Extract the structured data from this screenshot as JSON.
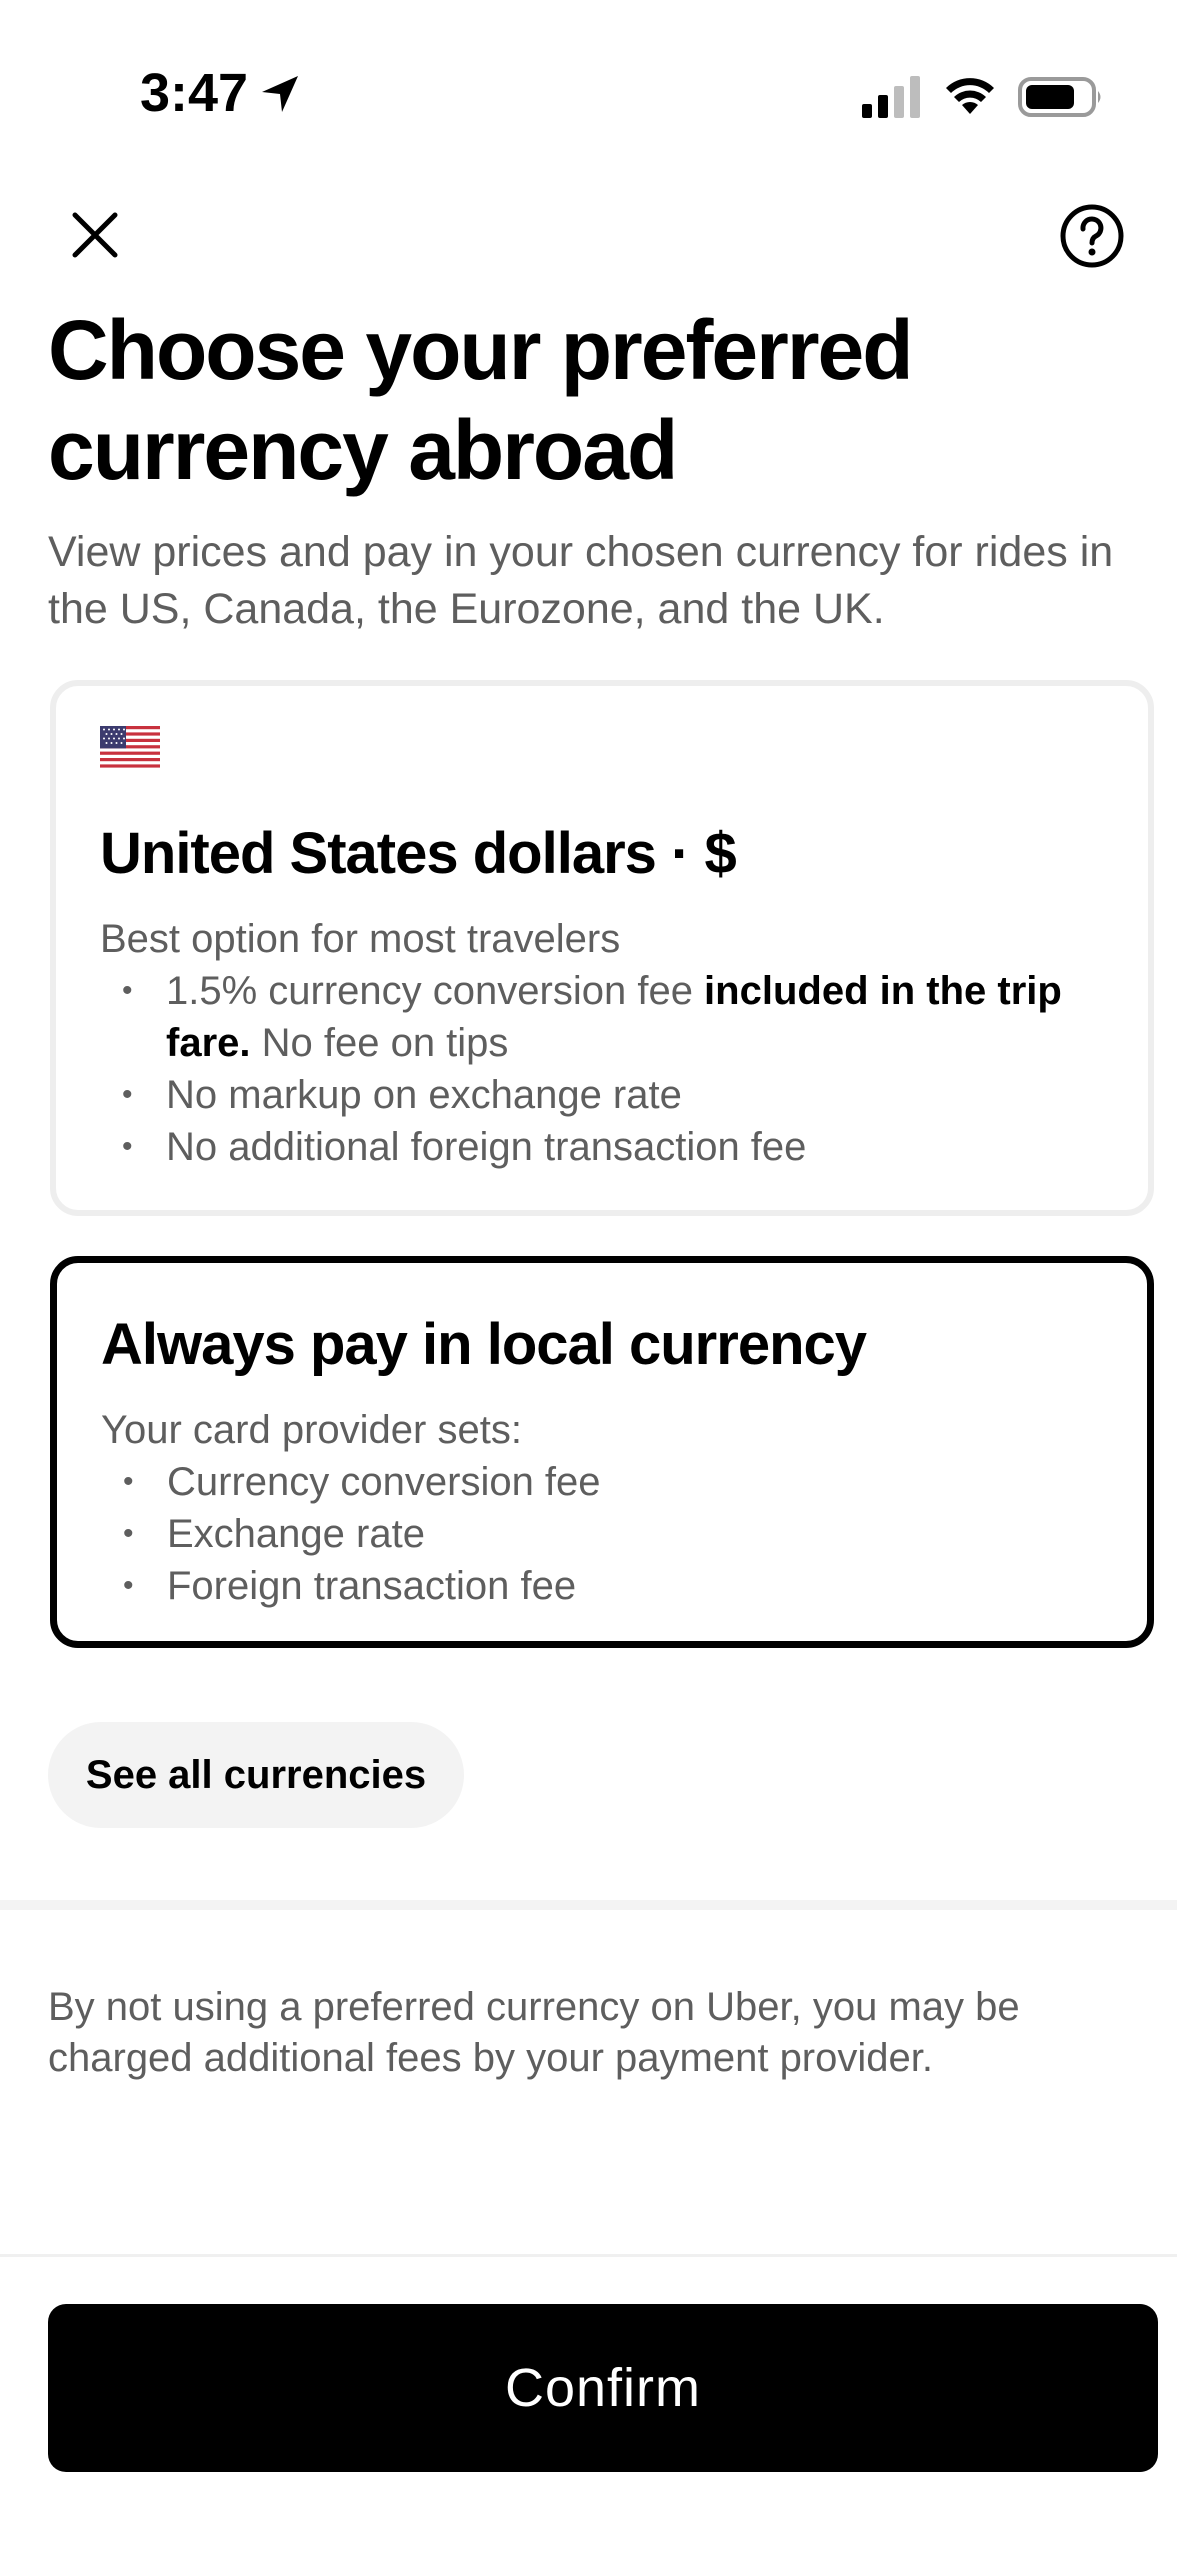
{
  "status_bar": {
    "time": "3:47"
  },
  "header": {
    "title": "Choose your preferred currency abroad",
    "subtitle": "View prices and pay in your chosen currency for rides in the US, Canada, the Eurozone, and the UK."
  },
  "options": [
    {
      "title": "United States dollars · $",
      "description": "Best option for most travelers",
      "bullets": [
        {
          "text": "1.5% currency conversion fee ",
          "bold": "included in the trip fare.",
          "suffix": " No fee on tips"
        },
        {
          "text": "No markup on exchange rate"
        },
        {
          "text": "No additional foreign transaction fee"
        }
      ]
    },
    {
      "title": "Always pay in local currency",
      "description": "Your card provider sets:",
      "bullets": [
        {
          "text": "Currency conversion fee"
        },
        {
          "text": "Exchange rate"
        },
        {
          "text": "Foreign transaction fee"
        }
      ],
      "selected": true
    }
  ],
  "see_all_label": "See all currencies",
  "disclaimer": "By not using a preferred currency on Uber, you may be charged additional fees by your payment provider.",
  "confirm_label": "Confirm",
  "icons": {
    "close": "close-icon",
    "help": "help-icon",
    "flag": "us-flag-icon"
  },
  "colors": {
    "primary": "#000000",
    "secondary_text": "#5e5e5e",
    "chip_background": "#f3f3f3",
    "card_border": "#eeeeee"
  }
}
